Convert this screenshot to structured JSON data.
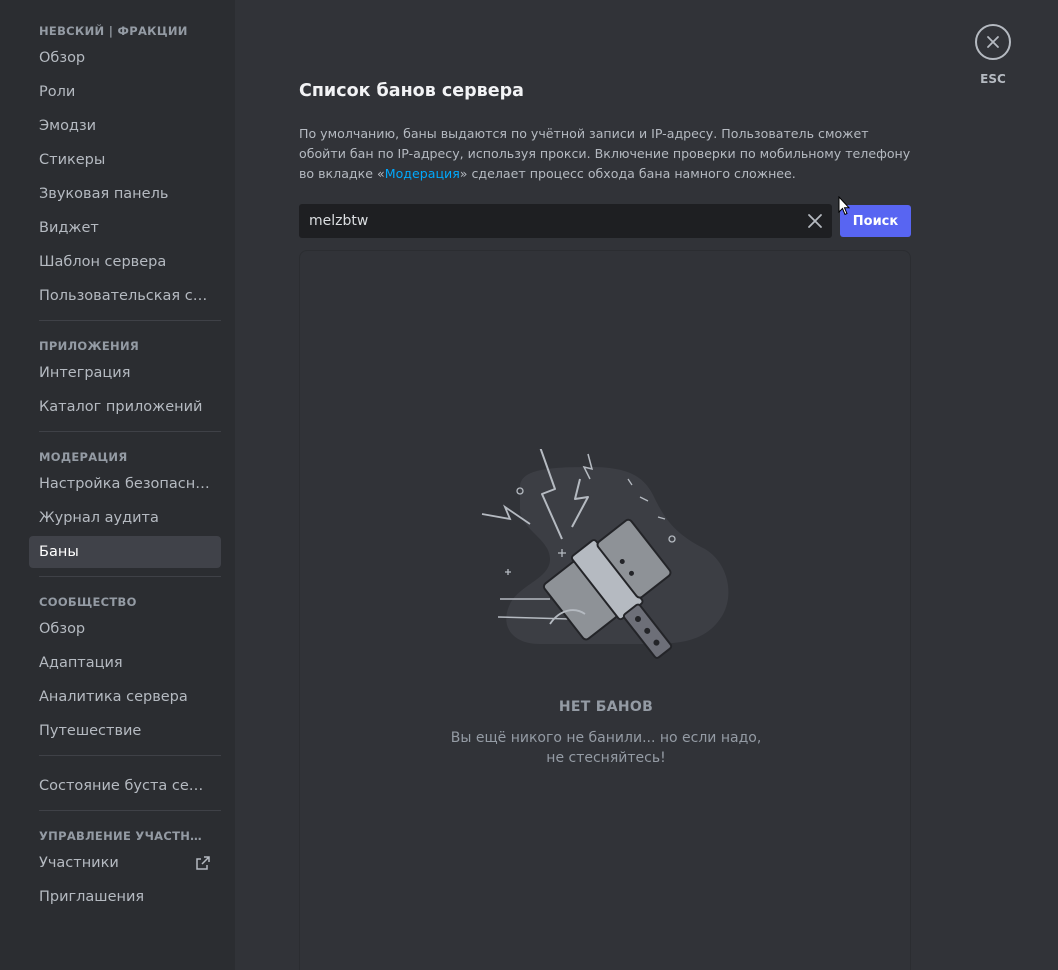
{
  "sidebar": {
    "sections": [
      {
        "title": "НЕВСКИЙ | ФРАКЦИИ",
        "items": [
          {
            "label": "Обзор"
          },
          {
            "label": "Роли"
          },
          {
            "label": "Эмодзи"
          },
          {
            "label": "Стикеры"
          },
          {
            "label": "Звуковая панель"
          },
          {
            "label": "Виджет"
          },
          {
            "label": "Шаблон сервера"
          },
          {
            "label": "Пользовательская сс..."
          }
        ]
      },
      {
        "title": "ПРИЛОЖЕНИЯ",
        "items": [
          {
            "label": "Интеграция"
          },
          {
            "label": "Каталог приложений"
          }
        ]
      },
      {
        "title": "МОДЕРАЦИЯ",
        "items": [
          {
            "label": "Настройка безопасно..."
          },
          {
            "label": "Журнал аудита"
          },
          {
            "label": "Баны",
            "active": true
          }
        ]
      },
      {
        "title": "СООБЩЕСТВО",
        "items": [
          {
            "label": "Обзор"
          },
          {
            "label": "Адаптация"
          },
          {
            "label": "Аналитика сервера"
          },
          {
            "label": "Путешествие"
          }
        ]
      },
      {
        "title": "",
        "items": [
          {
            "label": "Состояние буста сервера"
          }
        ]
      },
      {
        "title": "УПРАВЛЕНИЕ УЧАСТНИКА...",
        "items": [
          {
            "label": "Участники",
            "icon": "external-link-icon"
          },
          {
            "label": "Приглашения"
          }
        ]
      }
    ]
  },
  "main": {
    "title": "Список банов сервера",
    "description": {
      "before_link": "По умолчанию, баны выдаются по учётной записи и IP-адресу. Пользователь сможет обойти бан по IP-адресу, используя прокси. Включение проверки по мобильному телефону во вкладке «",
      "link": "Модерация",
      "after_link": "» сделает процесс обхода бана намного сложнее."
    },
    "search": {
      "value": "melzbtw",
      "button_label": "Поиск",
      "clear_icon": "close-icon"
    },
    "empty_state": {
      "title": "НЕТ БАНОВ",
      "subtitle_line1": "Вы ещё никого не банили... но если надо,",
      "subtitle_line2": "не стесняйтесь!",
      "illustration": "ban-hammer-illustration"
    },
    "close": {
      "icon": "close-icon",
      "label": "ESC"
    }
  },
  "colors": {
    "background": "#313338",
    "sidebar": "#2b2d31",
    "accent": "#5865f2",
    "link": "#00a8fc",
    "input": "#1e1f22"
  }
}
